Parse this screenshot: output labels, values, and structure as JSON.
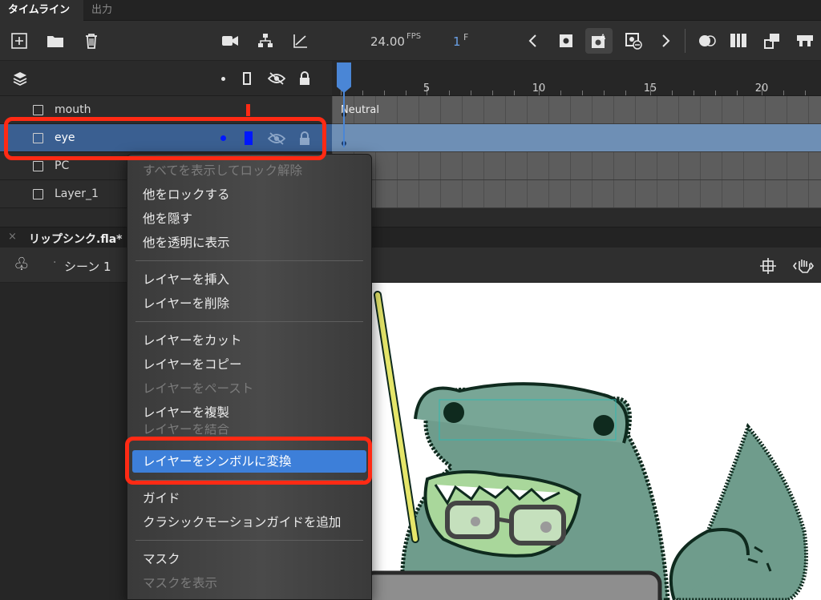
{
  "tabs": {
    "timeline": "タイムライン",
    "output": "出力"
  },
  "toolbar": {
    "fps_value": "24.00",
    "fps_unit": "FPS",
    "frame_value": "1",
    "frame_unit": "F"
  },
  "ruler": {
    "ticks": [
      "5",
      "10",
      "15",
      "20"
    ]
  },
  "layers": [
    {
      "name": "mouth"
    },
    {
      "name": "eye"
    },
    {
      "name": "PC"
    },
    {
      "name": "Layer_1"
    }
  ],
  "frames": {
    "mouth_label": "Neutral"
  },
  "document": {
    "tab_title": "リップシンク.fla*",
    "scene": "シーン 1"
  },
  "context_menu": {
    "show_all_unlock": "すべてを表示してロック解除",
    "lock_others": "他をロックする",
    "hide_others": "他を隠す",
    "others_outline": "他を透明に表示",
    "insert_layer": "レイヤーを挿入",
    "delete_layer": "レイヤーを削除",
    "cut_layer": "レイヤーをカット",
    "copy_layer": "レイヤーをコピー",
    "paste_layer": "レイヤーをペースト",
    "duplicate_layer": "レイヤーを複製",
    "merge_layers": "レイヤーを結合",
    "convert_to_symbol": "レイヤーをシンボルに変換",
    "guide": "ガイド",
    "add_classic_motion_guide": "クラシックモーションガイドを追加",
    "mask": "マスク",
    "show_masking": "マスクを表示"
  },
  "colors": {
    "accent": "#3d7fd9",
    "highlight": "#ff2a14",
    "selected_layer": "#3a5f91",
    "frog": "#6f9c8c"
  }
}
